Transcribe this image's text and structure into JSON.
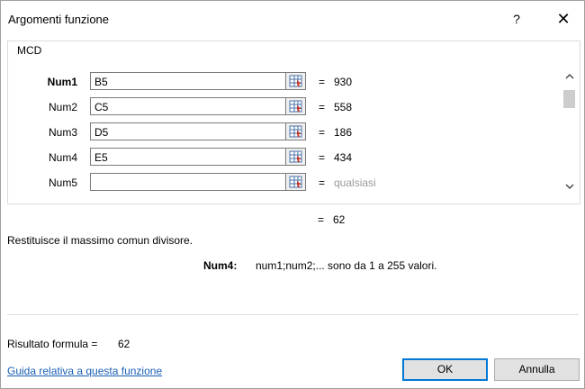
{
  "dialog": {
    "title": "Argomenti funzione",
    "help_label": "?",
    "close_label": "✕"
  },
  "function": {
    "name": "MCD",
    "arguments": [
      {
        "label": "Num1",
        "value": "B5",
        "result": "930",
        "bold": true
      },
      {
        "label": "Num2",
        "value": "C5",
        "result": "558"
      },
      {
        "label": "Num3",
        "value": "D5",
        "result": "186"
      },
      {
        "label": "Num4",
        "value": "E5",
        "result": "434"
      },
      {
        "label": "Num5",
        "value": "",
        "result": "qualsiasi"
      }
    ],
    "equals": "=",
    "result": "62",
    "description": "Restituisce il massimo comun divisore.",
    "arg_help_name": "Num4:",
    "arg_help_text": "num1;num2;... sono da 1 a 255 valori."
  },
  "footer": {
    "formula_result_label": "Risultato formula =",
    "formula_result_value": "62",
    "help_link": "Guida relativa a questa funzione",
    "ok_label": "OK",
    "cancel_label": "Annulla"
  },
  "icons": {
    "collapse": "range-selector-icon",
    "scroll_up": "chevron-up-icon",
    "scroll_down": "chevron-down-icon"
  }
}
